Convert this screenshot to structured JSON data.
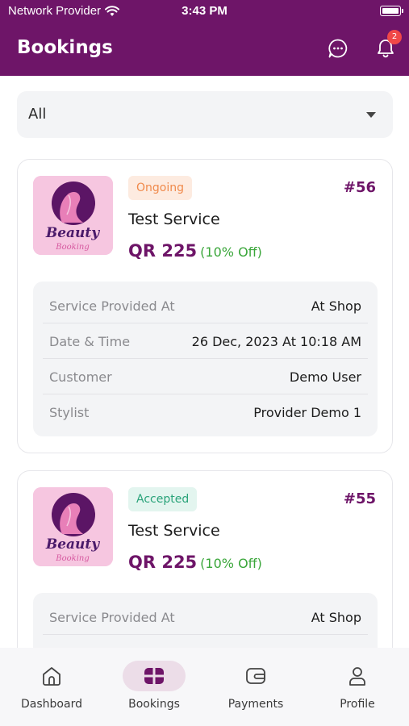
{
  "status_bar": {
    "carrier": "Network Provider",
    "time": "3:43 PM"
  },
  "header": {
    "title": "Bookings",
    "notification_count": "2",
    "bg_color": "#6e1568"
  },
  "filter": {
    "value": "All"
  },
  "bookings": [
    {
      "status": "Ongoing",
      "id": "#56",
      "service": "Test Service",
      "price": "QR 225",
      "discount": "(10% Off)",
      "logo_text": [
        "Beauty",
        "Booking"
      ],
      "details": [
        {
          "label": "Service Provided At",
          "value": "At Shop"
        },
        {
          "label": "Date & Time",
          "value": "26 Dec, 2023 At 10:18 AM"
        },
        {
          "label": "Customer",
          "value": "Demo User"
        },
        {
          "label": "Stylist",
          "value": "Provider Demo 1"
        }
      ]
    },
    {
      "status": "Accepted",
      "id": "#55",
      "service": "Test Service",
      "price": "QR 225",
      "discount": "(10% Off)",
      "logo_text": [
        "Beauty",
        "Booking"
      ],
      "details": [
        {
          "label": "Service Provided At",
          "value": "At Shop"
        }
      ]
    }
  ],
  "nav": {
    "items": [
      {
        "label": "Dashboard",
        "icon": "home-icon"
      },
      {
        "label": "Bookings",
        "icon": "bookings-icon",
        "active": true
      },
      {
        "label": "Payments",
        "icon": "wallet-icon"
      },
      {
        "label": "Profile",
        "icon": "profile-icon"
      }
    ]
  },
  "colors": {
    "accent": "#6e1568",
    "ongoing": "#f08a4b",
    "accepted": "#2aa37a",
    "discount": "#3aa63a"
  }
}
